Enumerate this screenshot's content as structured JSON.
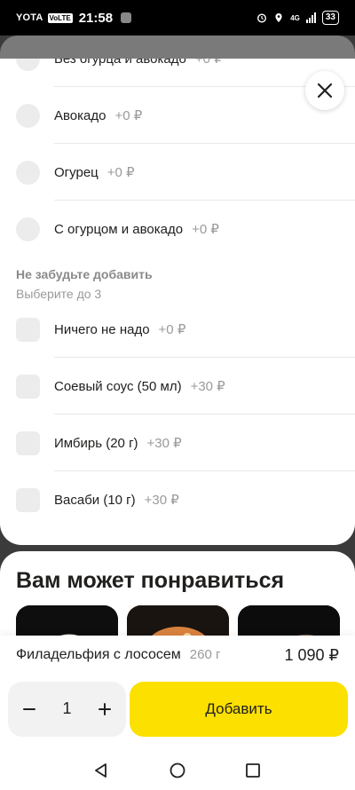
{
  "status_bar": {
    "carrier": "YOTA",
    "volte": "VoLTE",
    "time": "21:58",
    "network": "4G",
    "battery": "33"
  },
  "sheet": {
    "cut_option": {
      "label": "Без огурца и авокадо",
      "price": "+0 ₽"
    },
    "radio_options": [
      {
        "label": "Авокадо",
        "price": "+0 ₽"
      },
      {
        "label": "Огурец",
        "price": "+0 ₽"
      },
      {
        "label": "С огурцом и авокадо",
        "price": "+0 ₽"
      }
    ],
    "addons_group": {
      "title": "Не забудьте добавить",
      "subtitle": "Выберите до 3"
    },
    "addon_options": [
      {
        "label": "Ничего не надо",
        "price": "+0 ₽"
      },
      {
        "label": "Соевый соус (50 мл)",
        "price": "+30 ₽"
      },
      {
        "label": "Имбирь (20 г)",
        "price": "+30 ₽"
      },
      {
        "label": "Васаби (10 г)",
        "price": "+30 ₽"
      }
    ]
  },
  "recommendations": {
    "title": "Вам может понравиться"
  },
  "product": {
    "name": "Филадельфия с лососем",
    "weight": "260 г",
    "price": "1 090 ₽"
  },
  "cart": {
    "quantity": "1",
    "add_label": "Добавить"
  },
  "colors": {
    "accent": "#fce000",
    "text": "#21201f",
    "muted": "#9a9a9a"
  }
}
